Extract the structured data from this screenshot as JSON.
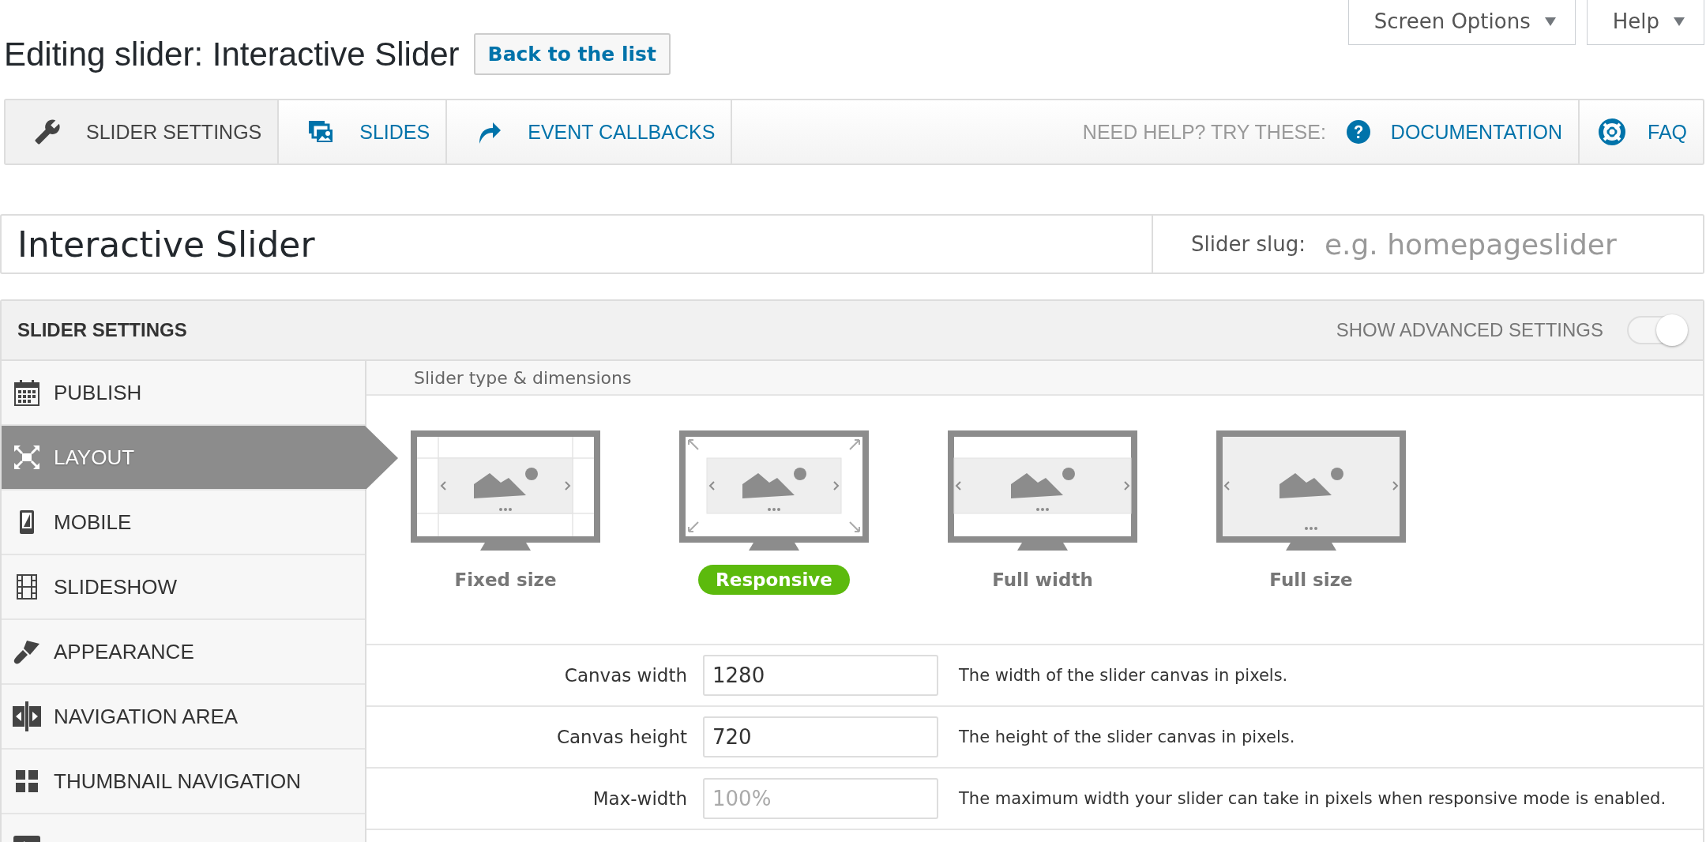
{
  "screen_meta": [
    {
      "label": "Screen Options"
    },
    {
      "label": "Help"
    }
  ],
  "header": {
    "title": "Editing slider: Interactive Slider",
    "back_button": "Back to the list"
  },
  "nav_tabs": [
    {
      "label": "SLIDER SETTINGS",
      "selected": true
    },
    {
      "label": "SLIDES",
      "selected": false
    },
    {
      "label": "EVENT CALLBACKS",
      "selected": false
    }
  ],
  "help": {
    "label": "NEED HELP? TRY THESE:",
    "links": [
      "DOCUMENTATION",
      "FAQ"
    ]
  },
  "slider_name": {
    "value": "Interactive Slider"
  },
  "slug": {
    "label": "Slider slug:",
    "placeholder": "e.g. homepageslider"
  },
  "settings": {
    "title": "SLIDER SETTINGS",
    "advanced": {
      "label": "SHOW ADVANCED SETTINGS",
      "on": true
    }
  },
  "sidebar": {
    "items": [
      {
        "label": "PUBLISH",
        "selected": false
      },
      {
        "label": "LAYOUT",
        "selected": true
      },
      {
        "label": "MOBILE",
        "selected": false
      },
      {
        "label": "SLIDESHOW",
        "selected": false
      },
      {
        "label": "APPEARANCE",
        "selected": false
      },
      {
        "label": "NAVIGATION AREA",
        "selected": false
      },
      {
        "label": "THUMBNAIL NAVIGATION",
        "selected": false
      },
      {
        "selected": false
      }
    ]
  },
  "section_title": "Slider type & dimensions",
  "slider_types": [
    {
      "kind": "fixed",
      "label": "Fixed size",
      "selected": false
    },
    {
      "kind": "responsive",
      "label": "Responsive",
      "selected": true
    },
    {
      "kind": "fullwidth",
      "label": "Full width",
      "selected": false
    },
    {
      "kind": "fullsize",
      "label": "Full size",
      "selected": false
    }
  ],
  "fields": [
    {
      "label": "Canvas width",
      "value": "1280",
      "description": "The width of the slider canvas in pixels."
    },
    {
      "label": "Canvas height",
      "value": "720",
      "description": "The height of the slider canvas in pixels."
    },
    {
      "label": "Max-width",
      "placeholder": "100%",
      "description": "The maximum width your slider can take in pixels when responsive mode is enabled."
    }
  ]
}
